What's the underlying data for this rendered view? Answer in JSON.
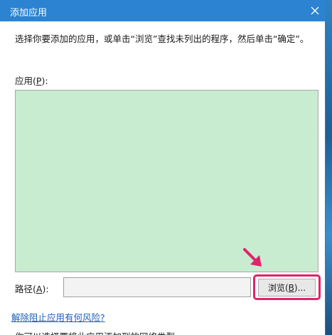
{
  "window": {
    "title": "添加应用",
    "close_icon": "close-icon"
  },
  "instruction": "选择你要添加的应用，或单击“浏览”查找未列出的程序，然后单击“确定”。",
  "apps": {
    "label_prefix": "应用(",
    "label_key": "P",
    "label_suffix": "):",
    "items": [],
    "background_color": "#c8ecd0"
  },
  "path": {
    "label_prefix": "路径(",
    "label_key": "A",
    "label_suffix": "):",
    "value": ""
  },
  "browse_button": {
    "label_prefix": "浏览(",
    "label_key": "B",
    "label_suffix": ")...",
    "highlight_color": "#e0236b"
  },
  "risk_link": "解除阻止应用有何风险?",
  "bottom_text": "你可以选择要将此应用添加到的网络类型"
}
